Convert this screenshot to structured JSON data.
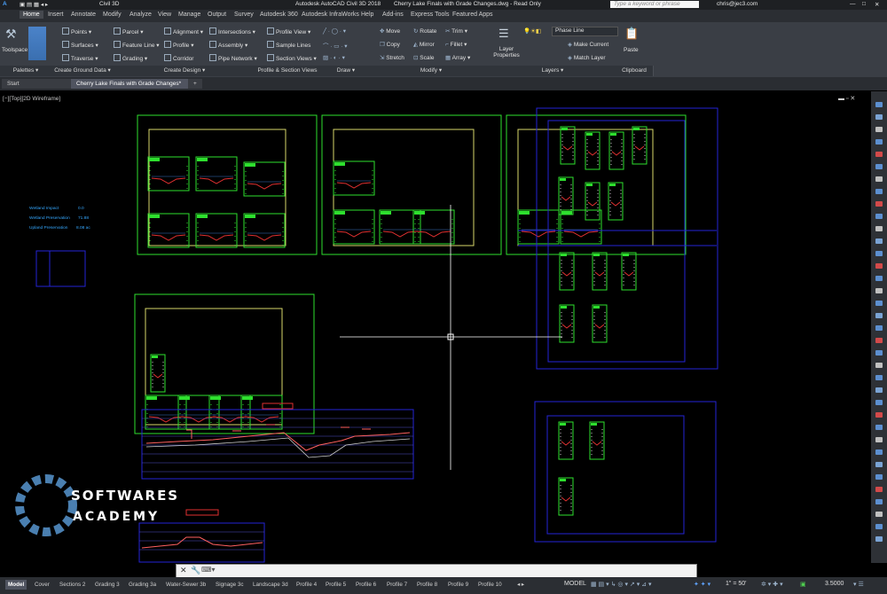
{
  "titlebar": {
    "workspace": "Civil 3D",
    "title": "Autodesk AutoCAD Civil 3D 2018",
    "filename": "Cherry Lake Finals with Grade Changes.dwg - Read Only",
    "search_placeholder": "Type a keyword or phrase",
    "user": "chris@jec3.com"
  },
  "ribbon_tabs": [
    "Home",
    "Insert",
    "Annotate",
    "Modify",
    "Analyze",
    "View",
    "Manage",
    "Output",
    "Survey",
    "Autodesk 360",
    "Autodesk InfraWorks",
    "Help",
    "Add-ins",
    "Express Tools",
    "Featured Apps"
  ],
  "ribbon": {
    "toolspace": "Toolspace",
    "create_ground": [
      "Points",
      "Surfaces",
      "Traverse"
    ],
    "create_design_a": [
      "Parcel",
      "Feature Line",
      "Grading"
    ],
    "create_design_b": [
      "Alignment",
      "Profile",
      "Corridor"
    ],
    "create_design_c": [
      "Intersections",
      "Assembly",
      "Pipe Network"
    ],
    "profile_section": [
      "Profile View",
      "Sample Lines",
      "Section Views"
    ],
    "modify_a": [
      "Move",
      "Copy",
      "Stretch"
    ],
    "modify_b": [
      "Rotate",
      "Mirror",
      "Scale"
    ],
    "modify_c": [
      "Trim",
      "Fillet",
      "Array"
    ],
    "layer_properties": "Layer Properties",
    "layer_name": "Phase Line",
    "make_current": "Make Current",
    "match_layer": "Match Layer",
    "paste": "Paste",
    "panels": [
      "Palettes",
      "Create Ground Data",
      "Create Design",
      "Profile & Section Views",
      "Draw",
      "Modify",
      "Layers",
      "Clipboard"
    ]
  },
  "doc_tabs": {
    "start": "Start",
    "active": "Cherry Lake Finals with Grade Changes*"
  },
  "viewport_label": "[−][Top][2D Wireframe]",
  "wetland_labels": [
    "Wetland Impact",
    "Wetland Preservation",
    "Upland Preservation"
  ],
  "wetland_values": [
    "0.0",
    "71.88",
    "8.08 ac"
  ],
  "watermark": {
    "line1": "SOFTWARES",
    "line2": "ACADEMY"
  },
  "layout_tabs": [
    "Model",
    "Cover",
    "Sections 2",
    "Grading 3",
    "Grading 3a",
    "Water-Sewer 3b",
    "Signage 3c",
    "Landscape 3d",
    "Profile 4",
    "Profile 5",
    "Profile 6",
    "Profile 7",
    "Profile 8",
    "Profile 9",
    "Profile 10"
  ],
  "status": {
    "model": "MODEL",
    "scale": "1\" = 50'",
    "value": "3.5000"
  },
  "colors": {
    "green": "#2ee02e",
    "blue": "#2424d6",
    "yellow": "#d7d76a",
    "red": "#e03030",
    "cyan": "#35a8ff",
    "accent": "#3a75c4"
  }
}
